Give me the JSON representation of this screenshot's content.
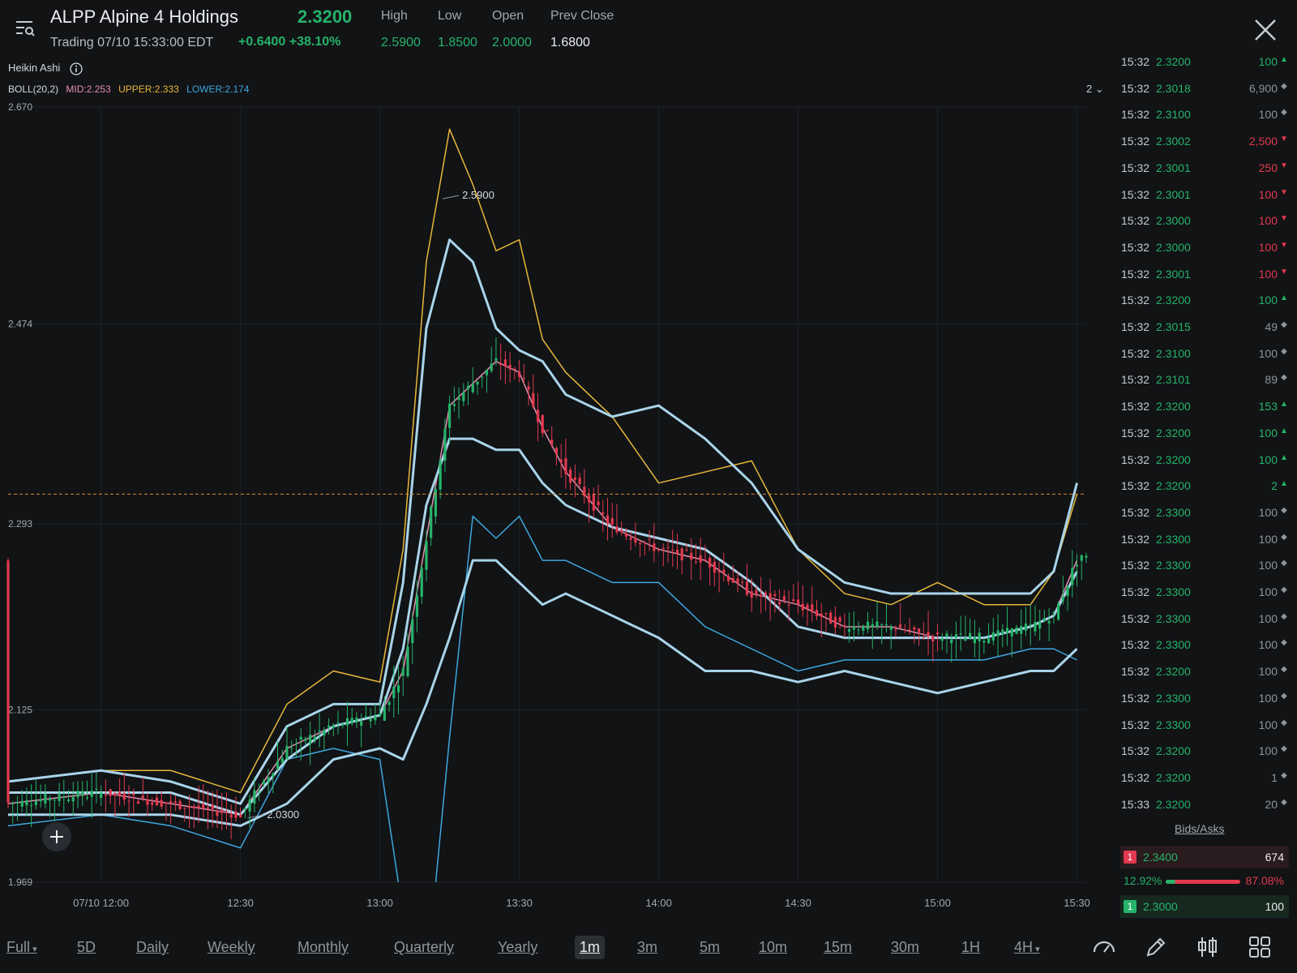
{
  "header": {
    "symbol": "ALPP Alpine 4 Holdings",
    "last_price": "2.3200",
    "status": "Trading 07/10 15:33:00 EDT",
    "change": "+0.6400",
    "change_pct": "+38.10%",
    "stats": [
      {
        "label": "High",
        "value": "2.5900"
      },
      {
        "label": "Low",
        "value": "1.8500"
      },
      {
        "label": "Open",
        "value": "2.0000"
      },
      {
        "label": "Prev Close",
        "value": "1.6800"
      }
    ],
    "menu_icon": "menu-search-icon",
    "close_icon": "close-icon"
  },
  "indicator": {
    "chart_style": "Heikin Ashi",
    "boll_name": "BOLL(20,2)",
    "boll_mid": "MID:2.253",
    "boll_upper": "UPPER:2.333",
    "boll_lower": "LOWER:2.174",
    "panel_count": "2"
  },
  "chart_data": {
    "type": "line",
    "chart_style": "Heikin Ashi candlesticks with Bollinger Bands",
    "y_ticks": [
      "2.670",
      "2.474",
      "2.293",
      "2.125",
      "1.969"
    ],
    "x_ticks": [
      "07/10 12:00",
      "12:30",
      "13:00",
      "13:30",
      "14:00",
      "14:30",
      "15:00",
      "15:30"
    ],
    "ylim": [
      1.969,
      2.67
    ],
    "x": [
      "11:40",
      "12:00",
      "12:15",
      "12:30",
      "12:40",
      "12:50",
      "13:00",
      "13:05",
      "13:10",
      "13:15",
      "13:20",
      "13:25",
      "13:30",
      "13:35",
      "13:40",
      "13:50",
      "14:00",
      "14:10",
      "14:20",
      "14:30",
      "14:40",
      "14:50",
      "15:00",
      "15:10",
      "15:20",
      "15:25",
      "15:30"
    ],
    "series": [
      {
        "name": "UPPER",
        "color": "#e8b73a",
        "values": [
          2.06,
          2.07,
          2.07,
          2.05,
          2.13,
          2.16,
          2.15,
          2.27,
          2.53,
          2.65,
          2.6,
          2.54,
          2.55,
          2.46,
          2.43,
          2.39,
          2.33,
          2.34,
          2.35,
          2.27,
          2.23,
          2.22,
          2.24,
          2.22,
          2.22,
          2.25,
          2.32
        ]
      },
      {
        "name": "MID",
        "color": "#e58fb0",
        "values": [
          2.04,
          2.05,
          2.04,
          2.03,
          2.09,
          2.11,
          2.12,
          2.16,
          2.28,
          2.4,
          2.42,
          2.44,
          2.43,
          2.38,
          2.34,
          2.29,
          2.27,
          2.26,
          2.23,
          2.22,
          2.2,
          2.2,
          2.19,
          2.19,
          2.2,
          2.21,
          2.26
        ]
      },
      {
        "name": "LOWER",
        "color": "#3fa6de",
        "values": [
          2.02,
          2.03,
          2.02,
          2.0,
          2.08,
          2.09,
          2.08,
          1.94,
          1.88,
          2.1,
          2.3,
          2.28,
          2.3,
          2.26,
          2.26,
          2.24,
          2.24,
          2.2,
          2.18,
          2.16,
          2.17,
          2.17,
          2.17,
          2.17,
          2.18,
          2.18,
          2.17
        ]
      },
      {
        "name": "Band outer high",
        "color": "#a9d4ea",
        "values": [
          2.06,
          2.07,
          2.06,
          2.04,
          2.11,
          2.13,
          2.13,
          2.24,
          2.47,
          2.55,
          2.53,
          2.47,
          2.45,
          2.44,
          2.41,
          2.39,
          2.4,
          2.37,
          2.33,
          2.27,
          2.24,
          2.23,
          2.23,
          2.23,
          2.23,
          2.25,
          2.33
        ]
      },
      {
        "name": "Band middle",
        "color": "#a9d4ea",
        "values": [
          2.05,
          2.05,
          2.05,
          2.03,
          2.08,
          2.11,
          2.12,
          2.18,
          2.31,
          2.37,
          2.37,
          2.36,
          2.36,
          2.33,
          2.31,
          2.29,
          2.28,
          2.27,
          2.24,
          2.2,
          2.19,
          2.19,
          2.19,
          2.19,
          2.2,
          2.21,
          2.25
        ]
      },
      {
        "name": "Band outer low",
        "color": "#a9d4ea",
        "values": [
          2.03,
          2.03,
          2.03,
          2.02,
          2.04,
          2.08,
          2.09,
          2.08,
          2.13,
          2.19,
          2.26,
          2.26,
          2.24,
          2.22,
          2.23,
          2.21,
          2.19,
          2.16,
          2.16,
          2.15,
          2.16,
          2.15,
          2.14,
          2.15,
          2.16,
          2.16,
          2.18
        ]
      }
    ],
    "price_line": 2.32,
    "annotations": [
      {
        "text": "2.5900",
        "x": "13:17",
        "y": 2.59
      },
      {
        "text": "2.0300",
        "x": "12:35",
        "y": 2.03
      }
    ],
    "grid": true,
    "legend": "top-left"
  },
  "ticks": [
    {
      "time": "15:32",
      "price": "2.3200",
      "volume": "100",
      "dir": "up"
    },
    {
      "time": "15:32",
      "price": "2.3018",
      "volume": "6,900",
      "dir": "neutral"
    },
    {
      "time": "15:32",
      "price": "2.3100",
      "volume": "100",
      "dir": "neutral"
    },
    {
      "time": "15:32",
      "price": "2.3002",
      "volume": "2,500",
      "dir": "down"
    },
    {
      "time": "15:32",
      "price": "2.3001",
      "volume": "250",
      "dir": "down"
    },
    {
      "time": "15:32",
      "price": "2.3001",
      "volume": "100",
      "dir": "down"
    },
    {
      "time": "15:32",
      "price": "2.3000",
      "volume": "100",
      "dir": "down"
    },
    {
      "time": "15:32",
      "price": "2.3000",
      "volume": "100",
      "dir": "down"
    },
    {
      "time": "15:32",
      "price": "2.3001",
      "volume": "100",
      "dir": "down"
    },
    {
      "time": "15:32",
      "price": "2.3200",
      "volume": "100",
      "dir": "up"
    },
    {
      "time": "15:32",
      "price": "2.3015",
      "volume": "49",
      "dir": "neutral"
    },
    {
      "time": "15:32",
      "price": "2.3100",
      "volume": "100",
      "dir": "neutral"
    },
    {
      "time": "15:32",
      "price": "2.3101",
      "volume": "89",
      "dir": "neutral"
    },
    {
      "time": "15:32",
      "price": "2.3200",
      "volume": "153",
      "dir": "up"
    },
    {
      "time": "15:32",
      "price": "2.3200",
      "volume": "100",
      "dir": "up"
    },
    {
      "time": "15:32",
      "price": "2.3200",
      "volume": "100",
      "dir": "up"
    },
    {
      "time": "15:32",
      "price": "2.3200",
      "volume": "2",
      "dir": "up"
    },
    {
      "time": "15:32",
      "price": "2.3300",
      "volume": "100",
      "dir": "neutral"
    },
    {
      "time": "15:32",
      "price": "2.3300",
      "volume": "100",
      "dir": "neutral"
    },
    {
      "time": "15:32",
      "price": "2.3300",
      "volume": "100",
      "dir": "neutral"
    },
    {
      "time": "15:32",
      "price": "2.3300",
      "volume": "100",
      "dir": "neutral"
    },
    {
      "time": "15:32",
      "price": "2.3300",
      "volume": "100",
      "dir": "neutral"
    },
    {
      "time": "15:32",
      "price": "2.3300",
      "volume": "100",
      "dir": "neutral"
    },
    {
      "time": "15:32",
      "price": "2.3200",
      "volume": "100",
      "dir": "neutral"
    },
    {
      "time": "15:32",
      "price": "2.3300",
      "volume": "100",
      "dir": "neutral"
    },
    {
      "time": "15:32",
      "price": "2.3300",
      "volume": "100",
      "dir": "neutral"
    },
    {
      "time": "15:32",
      "price": "2.3200",
      "volume": "100",
      "dir": "neutral"
    },
    {
      "time": "15:32",
      "price": "2.3200",
      "volume": "1",
      "dir": "neutral"
    },
    {
      "time": "15:33",
      "price": "2.3200",
      "volume": "20",
      "dir": "neutral"
    }
  ],
  "bidasks": {
    "title": "Bids/Asks",
    "ask": {
      "level": "1",
      "price": "2.3400",
      "size": "674"
    },
    "bid": {
      "level": "1",
      "price": "2.3000",
      "size": "100"
    },
    "bid_pct": "12.92%",
    "ask_pct": "87.08%",
    "bid_fraction": 0.1292
  },
  "periods": [
    {
      "label": "Full",
      "dropdown": true,
      "active": false
    },
    {
      "label": "5D",
      "active": false
    },
    {
      "label": "Daily",
      "active": false
    },
    {
      "label": "Weekly",
      "active": false
    },
    {
      "label": "Monthly",
      "active": false
    },
    {
      "label": "Quarterly",
      "active": false
    },
    {
      "label": "Yearly",
      "active": false
    },
    {
      "label": "1m",
      "active": true
    },
    {
      "label": "3m",
      "active": false
    },
    {
      "label": "5m",
      "active": false
    },
    {
      "label": "10m",
      "active": false
    },
    {
      "label": "15m",
      "active": false
    },
    {
      "label": "30m",
      "active": false
    },
    {
      "label": "1H",
      "active": false
    },
    {
      "label": "4H",
      "dropdown": true,
      "active": false
    }
  ],
  "tools": [
    "gauge-icon",
    "pencil-icon",
    "indicator-icon",
    "grid-icon"
  ],
  "colors": {
    "up": "#26b36a",
    "down": "#e2394e",
    "neutral": "#8f959b",
    "background": "#111315"
  }
}
